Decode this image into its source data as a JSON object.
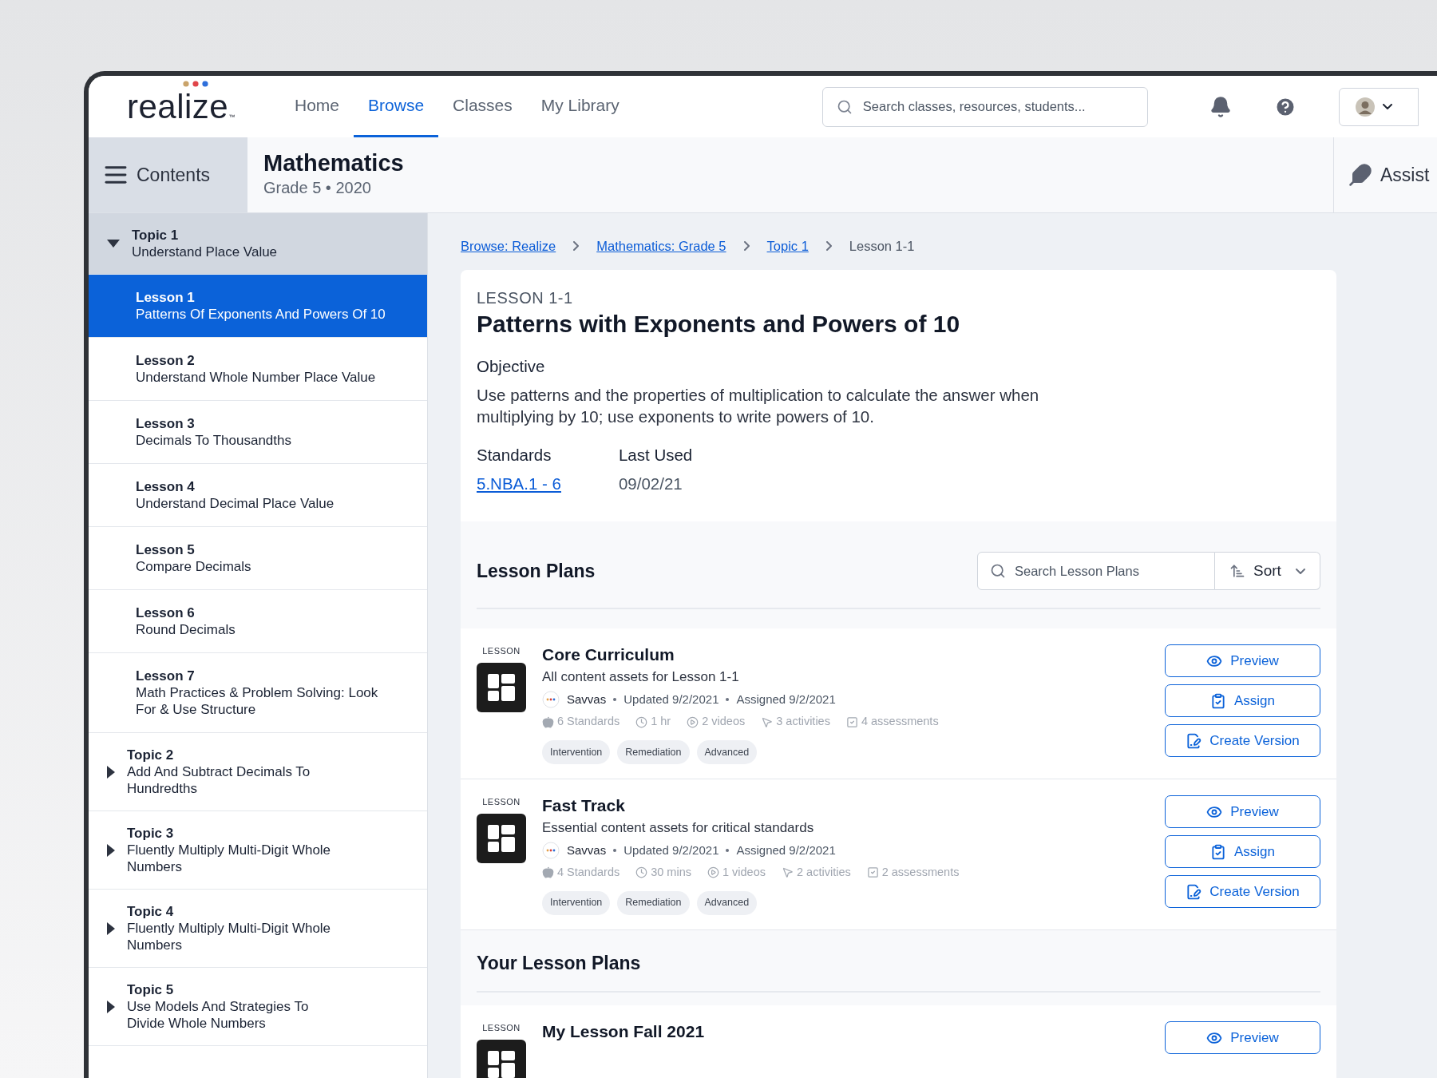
{
  "nav": {
    "logo": {
      "text": "realize",
      "mark": "™"
    },
    "items": [
      {
        "label": "Home",
        "selected": false
      },
      {
        "label": "Browse",
        "selected": true
      },
      {
        "label": "Classes",
        "selected": false
      },
      {
        "label": "My Library",
        "selected": false
      }
    ],
    "search": {
      "placeholder": "Search classes, resources, students..."
    }
  },
  "header": {
    "contents_label": "Contents",
    "title": "Mathematics",
    "subtitle": "Grade 5 • 2020",
    "assistant_label": "Assist"
  },
  "sidebar": {
    "topics": [
      {
        "label": "Topic 1",
        "title": "Understand Place Value",
        "expanded": true,
        "children": [
          {
            "label": "Lesson 1",
            "title": "Patterns Of Exponents And Powers Of 10",
            "selected": true
          },
          {
            "label": "Lesson 2",
            "title": "Understand Whole Number Place Value",
            "selected": false
          },
          {
            "label": "Lesson 3",
            "title": "Decimals To Thousandths",
            "selected": false
          },
          {
            "label": "Lesson 4",
            "title": "Understand Decimal Place Value",
            "selected": false
          },
          {
            "label": "Lesson 5",
            "title": "Compare Decimals",
            "selected": false
          },
          {
            "label": "Lesson 6",
            "title": "Round Decimals",
            "selected": false
          },
          {
            "label": "Lesson 7",
            "title": "Math Practices & Problem Solving: Look For & Use Structure",
            "selected": false
          }
        ]
      },
      {
        "label": "Topic 2",
        "title": "Add And Subtract Decimals To Hundredths",
        "expanded": false
      },
      {
        "label": "Topic 3",
        "title": "Fluently Multiply Multi-Digit Whole Numbers",
        "expanded": false
      },
      {
        "label": "Topic 4",
        "title": "Fluently Multiply Multi-Digit Whole Numbers",
        "expanded": false
      },
      {
        "label": "Topic 5",
        "title": "Use Models And Strategies To Divide Whole Numbers",
        "expanded": false
      }
    ]
  },
  "breadcrumbs": [
    {
      "label": "Browse: Realize",
      "kind": "link"
    },
    {
      "label": "Mathematics: Grade 5",
      "kind": "link"
    },
    {
      "label": "Topic 1",
      "kind": "link"
    },
    {
      "label": "Lesson 1-1",
      "kind": "current"
    }
  ],
  "lesson": {
    "eyebrow": "LESSON 1-1",
    "title": "Patterns with Exponents and Powers of 10",
    "objective_heading": "Objective",
    "objective": "Use patterns and the properties of multiplication to calculate the answer when multiplying by 10; use exponents to write powers of 10.",
    "standards_heading": "Standards",
    "standards": "5.NBA.1 - 6",
    "last_used_heading": "Last Used",
    "last_used": "09/02/21"
  },
  "lesson_plans": {
    "heading": "Lesson Plans",
    "search": {
      "placeholder": "Search Lesson Plans"
    },
    "sort_label": "Sort",
    "plans": [
      {
        "type_label": "LESSON",
        "title": "Core Curriculum",
        "description": "All content assets for Lesson 1-1",
        "meta": [
          "Savvas",
          "Updated 9/2/2021",
          "Assigned 9/2/2021"
        ],
        "stats": [
          {
            "kind": "standards",
            "text": "6 Standards"
          },
          {
            "kind": "time",
            "text": "1 hr"
          },
          {
            "kind": "videos",
            "text": "2 videos"
          },
          {
            "kind": "activities",
            "text": "3 activities"
          },
          {
            "kind": "assessments",
            "text": "4 assessments"
          }
        ],
        "tags": [
          "Intervention",
          "Remediation",
          "Advanced"
        ],
        "actions": [
          {
            "kind": "preview",
            "label": "Preview"
          },
          {
            "kind": "assign",
            "label": "Assign"
          },
          {
            "kind": "create",
            "label": "Create Version"
          }
        ]
      },
      {
        "type_label": "LESSON",
        "title": "Fast Track",
        "description": "Essential content assets for critical standards",
        "meta": [
          "Savvas",
          "Updated 9/2/2021",
          "Assigned 9/2/2021"
        ],
        "stats": [
          {
            "kind": "standards",
            "text": "4 Standards"
          },
          {
            "kind": "time",
            "text": "30 mins"
          },
          {
            "kind": "videos",
            "text": "1 videos"
          },
          {
            "kind": "activities",
            "text": "2 activities"
          },
          {
            "kind": "assessments",
            "text": "2 assessments"
          }
        ],
        "tags": [
          "Intervention",
          "Remediation",
          "Advanced"
        ],
        "actions": [
          {
            "kind": "preview",
            "label": "Preview"
          },
          {
            "kind": "assign",
            "label": "Assign"
          },
          {
            "kind": "create",
            "label": "Create Version"
          }
        ]
      }
    ]
  },
  "your_lesson_plans": {
    "heading": "Your Lesson Plans",
    "plans": [
      {
        "type_label": "LESSON",
        "title": "My Lesson Fall 2021",
        "actions": [
          {
            "kind": "preview",
            "label": "Preview"
          }
        ]
      }
    ]
  }
}
